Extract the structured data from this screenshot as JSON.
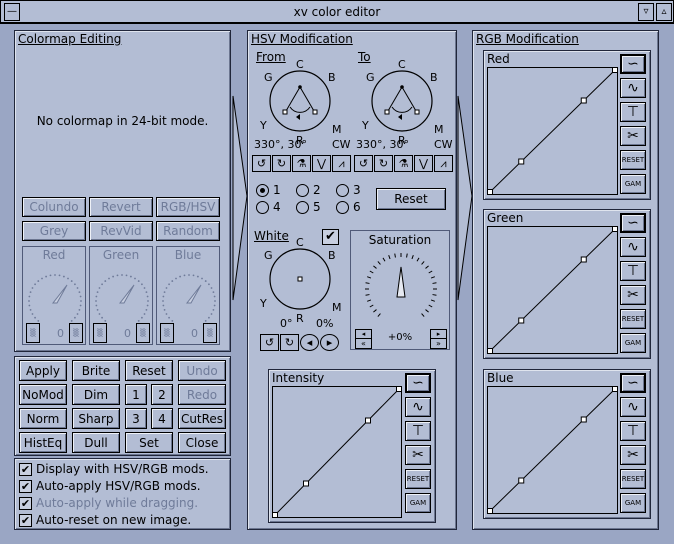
{
  "window": {
    "title": "xv color editor"
  },
  "colormap": {
    "heading": "Colormap Editing",
    "message": "No colormap in 24-bit mode.",
    "buttons": [
      "Colundo",
      "Revert",
      "RGB/HSV",
      "Grey",
      "RevVid",
      "Random"
    ],
    "dials": [
      "Red",
      "Green",
      "Blue"
    ],
    "dial_value": "0"
  },
  "controls": {
    "buttons": [
      "Apply",
      "Brite",
      "Reset",
      "Undo",
      "NoMod",
      "Dim",
      "1",
      "2",
      "Redo",
      "Norm",
      "Sharp",
      "3",
      "4",
      "CutRes",
      "HistEq",
      "Dull",
      "Set",
      "Close"
    ],
    "checkboxes": [
      {
        "label": "Display with HSV/RGB mods.",
        "checked": true
      },
      {
        "label": "Auto-apply HSV/RGB mods.",
        "checked": true
      },
      {
        "label": "Auto-apply while dragging.",
        "checked": true
      },
      {
        "label": "Auto-reset on new image.",
        "checked": true
      }
    ]
  },
  "hsv": {
    "heading": "HSV Modification",
    "from_label": "From",
    "to_label": "To",
    "wheel_labels": {
      "c": "C",
      "g": "G",
      "b": "B",
      "y": "Y",
      "m": "M",
      "r": "R"
    },
    "from_values": {
      "range": "330°, 30°",
      "dir": "CW"
    },
    "to_values": {
      "range": "330°, 30°",
      "dir": "CW"
    },
    "radios": [
      "1",
      "2",
      "3",
      "4",
      "5",
      "6"
    ],
    "selected_radio": "1",
    "reset": "Reset",
    "white_label": "White",
    "white_values": {
      "hue": "0°",
      "sat": "0%"
    },
    "saturation_label": "Saturation",
    "saturation_value": "+0%",
    "intensity_label": "Intensity"
  },
  "rgb": {
    "heading": "RGB Modification",
    "graphs": [
      "Red",
      "Green",
      "Blue"
    ]
  },
  "graph_tools": {
    "reset": "RESET",
    "gam": "GAM"
  }
}
